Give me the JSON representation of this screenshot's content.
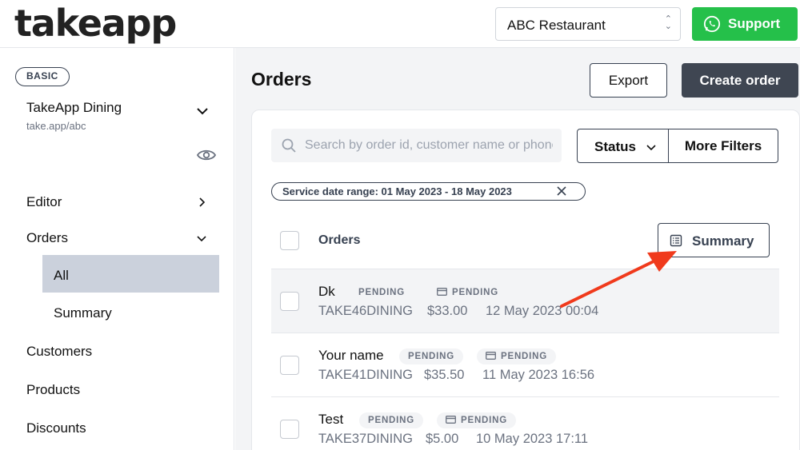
{
  "header": {
    "logo": "takeapp",
    "restaurant_select": "ABC Restaurant",
    "support_label": "Support"
  },
  "sidebar": {
    "plan_badge": "BASIC",
    "store_name": "TakeApp Dining",
    "store_url": "take.app/abc",
    "items": [
      {
        "label": "Editor"
      },
      {
        "label": "Orders"
      },
      {
        "label": "Customers"
      },
      {
        "label": "Products"
      },
      {
        "label": "Discounts"
      }
    ],
    "orders_sub": [
      {
        "label": "All",
        "active": true
      },
      {
        "label": "Summary",
        "active": false
      }
    ]
  },
  "main": {
    "title": "Orders",
    "export_label": "Export",
    "create_label": "Create order",
    "search_placeholder": "Search by order id, customer name or phone",
    "status_label": "Status",
    "more_filters_label": "More Filters",
    "date_chip": "Service date range: 01 May 2023 - 18 May 2023",
    "list_header": "Orders",
    "summary_label": "Summary",
    "orders": [
      {
        "name": "Dk",
        "status": "PENDING",
        "payment": "PENDING",
        "id": "TAKE46DINING",
        "amount": "$33.00",
        "date": "12 May 2023 00:04"
      },
      {
        "name": "Your name",
        "status": "PENDING",
        "payment": "PENDING",
        "id": "TAKE41DINING",
        "amount": "$35.50",
        "date": "11 May 2023 16:56"
      },
      {
        "name": "Test",
        "status": "PENDING",
        "payment": "PENDING",
        "id": "TAKE37DINING",
        "amount": "$5.00",
        "date": "10 May 2023 17:11"
      }
    ]
  },
  "colors": {
    "support_green": "#25c04a",
    "create_button": "#3f4652",
    "active_nav": "#cbd1dc",
    "arrow_red": "#f03a1c"
  }
}
